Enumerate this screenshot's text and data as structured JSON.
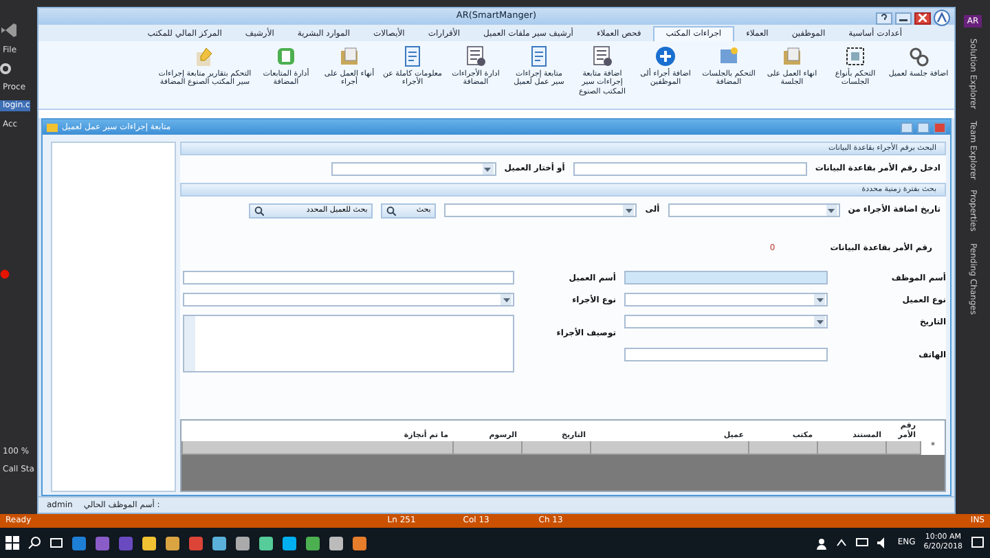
{
  "ide": {
    "menu": "File",
    "side_labels": [
      "Proce",
      "login.c",
      "Acc"
    ],
    "zoom": "100 %",
    "bottom_label": "Call Sta",
    "account_badge": "AR",
    "side_tabs": [
      "Solution Explorer",
      "Team Explorer",
      "Properties",
      "Pending Changes"
    ]
  },
  "app": {
    "title": "AR(SmartManger)",
    "tabs": [
      {
        "label": "أعدادت أساسية",
        "selected": false
      },
      {
        "label": "الموظفين",
        "selected": false
      },
      {
        "label": "العملاء",
        "selected": false
      },
      {
        "label": "اجراءات المكتب",
        "selected": true
      },
      {
        "label": "فحص العملاء",
        "selected": false
      },
      {
        "label": "أرشيف سير ملفات العميل",
        "selected": false
      },
      {
        "label": "الأقرارات",
        "selected": false
      },
      {
        "label": "الأيصالات",
        "selected": false
      },
      {
        "label": "الموارد البشرية",
        "selected": false
      },
      {
        "label": "الأرشيف",
        "selected": false
      },
      {
        "label": "المركز المالي للمكتب",
        "selected": false
      }
    ],
    "ribbon": [
      {
        "label": "اضافة جلسة لعميل",
        "kind": "link"
      },
      {
        "label": "التحكم بأنواع الجلسات",
        "kind": "frame"
      },
      {
        "label": "انهاء العمل على الجلسة",
        "kind": "folder"
      },
      {
        "label": "التحكم بالجلسات المضافة",
        "kind": "board"
      },
      {
        "label": "اضافة أجراء ألى الموظفين",
        "kind": "plus"
      },
      {
        "label": "اضافة متابعة إجراءات سير المكتب الصنوع",
        "kind": "list"
      },
      {
        "label": "متابعة إجراءات سير عمل لعميل",
        "kind": "doc"
      },
      {
        "label": "ادارة الأجراءات المضافة",
        "kind": "list"
      },
      {
        "label": "معلومات كاملة عن الأجراء",
        "kind": "doc"
      },
      {
        "label": "أنهاء العمل على أجراء",
        "kind": "folder"
      },
      {
        "label": "أدارة المتابعات المضافة",
        "kind": "note"
      },
      {
        "label": "التحكم بتقارير متابعة إجراءات سير المكتب الصنوع المضافة",
        "kind": "pencil"
      }
    ],
    "window": {
      "title": "متابعة إجراءات سير عمل لعميل",
      "search_group": {
        "title": "البحث برقم الأجراء بقاعدة البيانات",
        "order_label": "ادخل رقم الأمر بقاعدة البيانات",
        "client_label": "أو أختار العميل"
      },
      "period_group": {
        "title": "بحث بفترة زمنية محددة",
        "from_label": "تاريخ اضافة الأجراء من",
        "to_label": "ألى",
        "search_button": "بحث",
        "client_button": "بحث للعميل المحدد"
      },
      "order_number": {
        "label": "رقم الأمر  بقاعدة البيانات",
        "value": "0"
      },
      "fields": [
        {
          "label": "أسم الموظف",
          "kind": "input",
          "readonly": true
        },
        {
          "label": "أسم العميل",
          "kind": "input",
          "readonly": false
        },
        {
          "label": "نوع العميل",
          "kind": "select",
          "readonly": false
        },
        {
          "label": "نوع الأجراء",
          "kind": "select",
          "readonly": false
        },
        {
          "label": "التاريخ",
          "kind": "select",
          "readonly": false
        },
        {
          "label": "توصيف الأجراء",
          "kind": "textarea",
          "readonly": false
        },
        {
          "label": "الهاتف",
          "kind": "input",
          "readonly": false
        }
      ],
      "table": {
        "columns": [
          "رقم الأمر",
          "المستند",
          "مكتب",
          "عميل",
          "التاريخ",
          "الرسوم",
          "ما تم أنجازة"
        ],
        "new_row_marker": "*"
      }
    },
    "status": {
      "user": "admin",
      "label": "أسم الموظف الحالي :"
    }
  },
  "status_bar": {
    "state": "Ready",
    "ln": "Ln 251",
    "col": "Col 13",
    "ch": "Ch 13",
    "mode": "INS"
  },
  "taskbar": {
    "lang": "ENG",
    "time": "10:00 AM",
    "date": "6/20/2018"
  }
}
